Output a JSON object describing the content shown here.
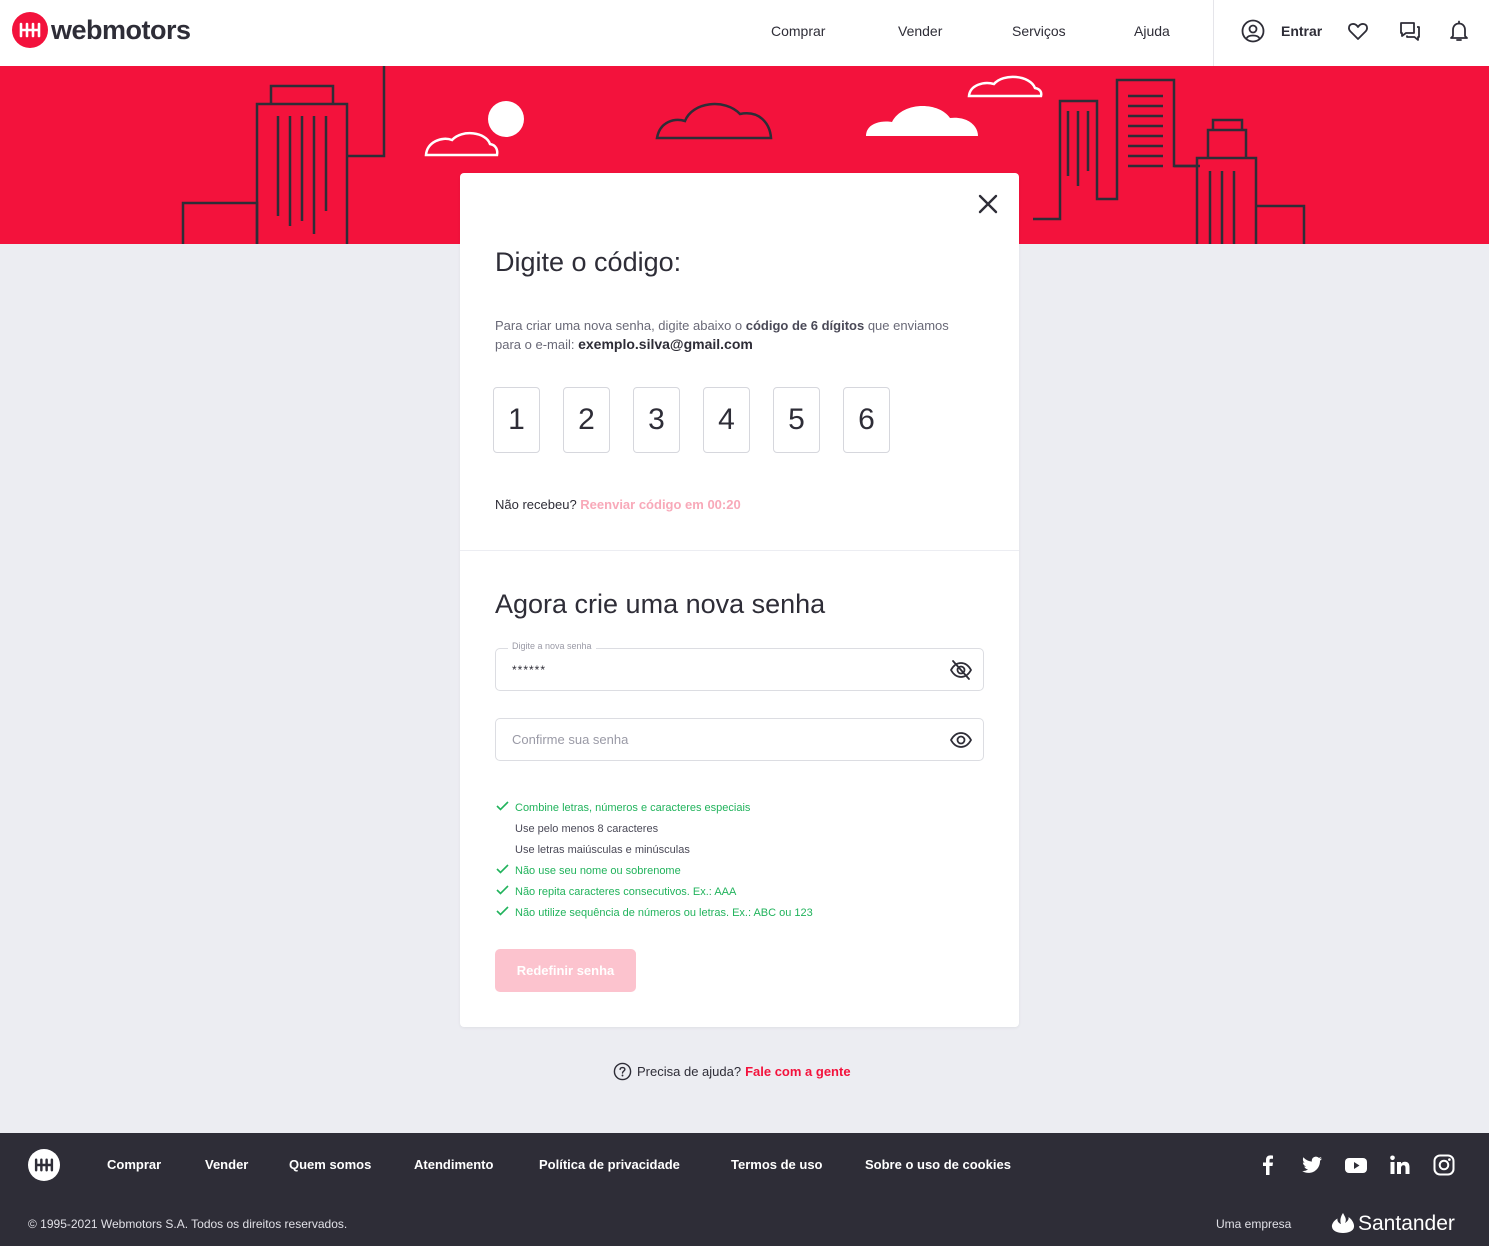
{
  "header": {
    "brand": "webmotors",
    "nav": [
      "Comprar",
      "Vender",
      "Serviços",
      "Ajuda"
    ],
    "login_label": "Entrar"
  },
  "card": {
    "code_title": "Digite o código:",
    "desc_before": "Para criar uma nova senha, digite abaixo o ",
    "desc_bold": "código de 6 dígitos",
    "desc_after": " que enviamos para o e-mail: ",
    "email": "exemplo.silva@gmail.com",
    "code_digits": [
      "1",
      "2",
      "3",
      "4",
      "5",
      "6"
    ],
    "resend_question": "Não recebeu?",
    "resend_link": "Reenviar código em 00:20",
    "password_title": "Agora crie uma nova senha",
    "new_password": {
      "label": "Digite a nova senha",
      "value": "******"
    },
    "confirm_password": {
      "placeholder": "Confirme sua senha"
    },
    "rules": [
      {
        "text": "Combine letras, números e caracteres especiais",
        "ok": true
      },
      {
        "text": "Use pelo menos 8 caracteres",
        "ok": false
      },
      {
        "text": "Use letras maiúsculas e minúsculas",
        "ok": false
      },
      {
        "text": "Não use seu nome ou sobrenome",
        "ok": true
      },
      {
        "text": "Não repita caracteres consecutivos. Ex.: AAA",
        "ok": true
      },
      {
        "text": "Não utilize sequência de números ou letras. Ex.: ABC ou 123",
        "ok": true
      }
    ],
    "submit_label": "Redefinir senha"
  },
  "help": {
    "question": "Precisa de ajuda?",
    "link": "Fale com a gente"
  },
  "footer": {
    "nav": [
      "Comprar",
      "Vender",
      "Quem somos",
      "Atendimento",
      "Política de privacidade",
      "Termos de uso",
      "Sobre o uso de cookies"
    ],
    "copyright": "© 1995-2021 Webmotors S.A. Todos os direitos reservados.",
    "company_prefix": "Uma empresa",
    "company": "Santander"
  },
  "colors": {
    "brand": "#f3123c",
    "dark": "#2e2d37",
    "success": "#21b35c",
    "background": "#ecedf2",
    "disabled_button": "#fcc3ce"
  }
}
